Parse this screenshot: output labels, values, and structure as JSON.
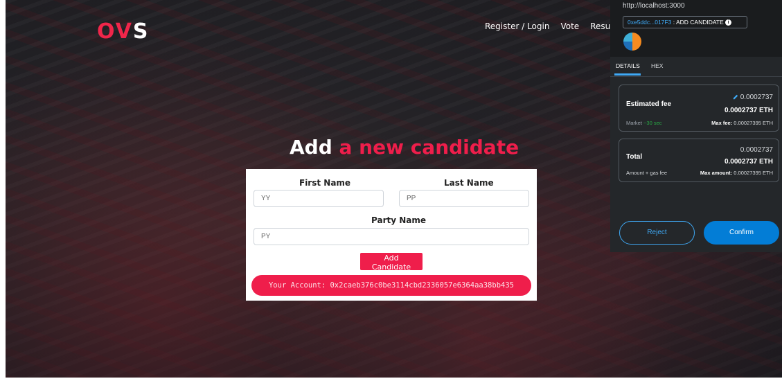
{
  "brand": {
    "logo_part1": "OV",
    "logo_part2": "S",
    "accent_color": "#ef1e4b"
  },
  "nav": {
    "items": [
      "Register / Login",
      "Vote",
      "Results"
    ]
  },
  "headline": {
    "part1": "Add ",
    "part2": "a new candidate"
  },
  "form": {
    "first_name_label": "First Name",
    "last_name_label": "Last Name",
    "party_name_label": "Party Name",
    "first_name_value": "YY",
    "last_name_value": "PP",
    "party_name_value": "PY",
    "submit_label": "Add Candidate",
    "account_text": "Your Account: 0x2caeb376c0be3114cbd2336057e6364aa38bb435"
  },
  "metamask": {
    "origin": "http://localhost:3000",
    "account_short": "0xe5ddc...017F3",
    "method": ": ADD CANDIDATE",
    "tabs": [
      "DETAILS",
      "HEX"
    ],
    "estimated_fee": {
      "label": "Estimated fee",
      "amount_top": "0.0002737",
      "amount_eth": "0.0002737 ETH",
      "market_label": "Market",
      "market_time": "~30 sec",
      "max_fee_label": "Max fee:",
      "max_fee_value": "0.00027395 ETH"
    },
    "total": {
      "label": "Total",
      "amount_top": "0.0002737",
      "amount_eth": "0.0002737 ETH",
      "sub_label": "Amount + gas fee",
      "max_amount_label": "Max amount:",
      "max_amount_value": "0.00027395 ETH"
    },
    "reject_label": "Reject",
    "confirm_label": "Confirm",
    "colors": {
      "primary": "#037dd6",
      "link": "#3fa9f5",
      "panel_bg": "#24272a"
    }
  }
}
